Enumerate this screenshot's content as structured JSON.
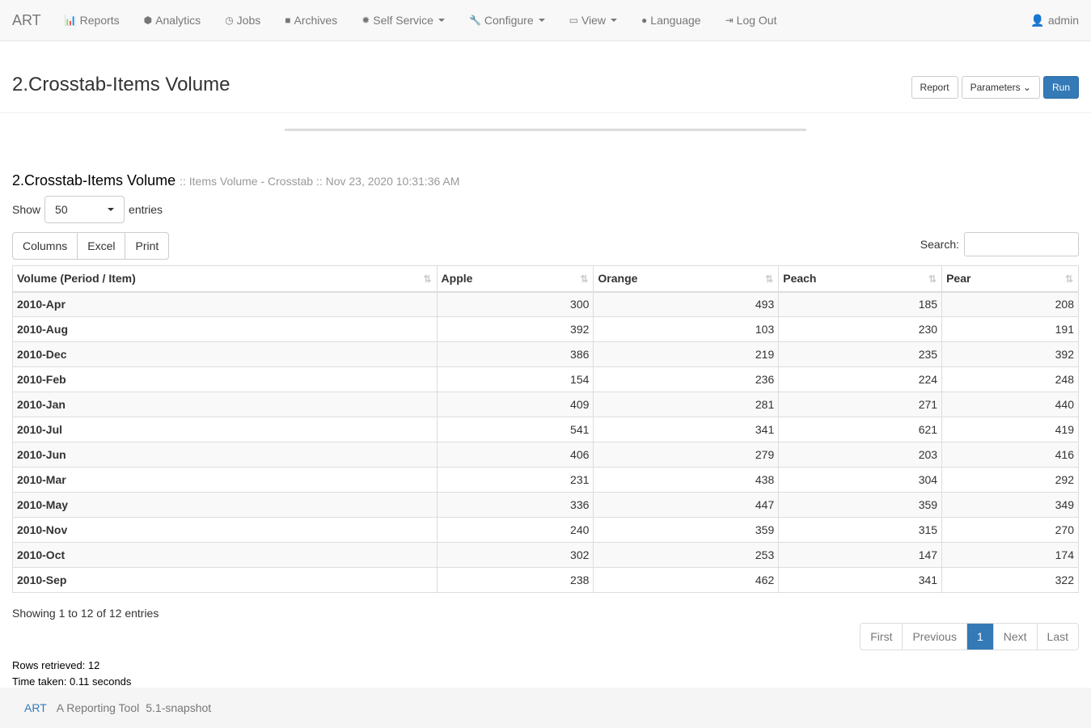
{
  "nav": {
    "brand": "ART",
    "items": [
      {
        "label": "Reports",
        "icon": "bar-chart-icon",
        "glyph": "📊"
      },
      {
        "label": "Analytics",
        "icon": "cubes-icon",
        "glyph": "⬢"
      },
      {
        "label": "Jobs",
        "icon": "clock-icon",
        "glyph": "◷"
      },
      {
        "label": "Archives",
        "icon": "archive-icon",
        "glyph": "■"
      },
      {
        "label": "Self Service",
        "icon": "gear-icon",
        "glyph": "✹"
      },
      {
        "label": "Configure",
        "icon": "wrench-icon",
        "glyph": "🔧"
      },
      {
        "label": "View",
        "icon": "monitor-icon",
        "glyph": "▭"
      },
      {
        "label": "Language",
        "icon": "comment-icon",
        "glyph": "●"
      },
      {
        "label": "Log Out",
        "icon": "logout-icon",
        "glyph": "⇥"
      }
    ],
    "user": "admin"
  },
  "header": {
    "title": "2.Crosstab-Items Volume",
    "report": "Report",
    "parameters": "Parameters",
    "run": "Run"
  },
  "report": {
    "title": "2.Crosstab-Items Volume",
    "subtitle": ":: Items Volume - Crosstab :: Nov 23, 2020 10:31:36 AM",
    "show": "Show",
    "entries_value": "50",
    "entries": "entries",
    "buttons": [
      "Columns",
      "Excel",
      "Print"
    ],
    "search": "Search:"
  },
  "table": {
    "headers": [
      "Volume (Period / Item)",
      "Apple",
      "Orange",
      "Peach",
      "Pear"
    ],
    "rows": [
      [
        "2010-Apr",
        "300",
        "493",
        "185",
        "208"
      ],
      [
        "2010-Aug",
        "392",
        "103",
        "230",
        "191"
      ],
      [
        "2010-Dec",
        "386",
        "219",
        "235",
        "392"
      ],
      [
        "2010-Feb",
        "154",
        "236",
        "224",
        "248"
      ],
      [
        "2010-Jan",
        "409",
        "281",
        "271",
        "440"
      ],
      [
        "2010-Jul",
        "541",
        "341",
        "621",
        "419"
      ],
      [
        "2010-Jun",
        "406",
        "279",
        "203",
        "416"
      ],
      [
        "2010-Mar",
        "231",
        "438",
        "304",
        "292"
      ],
      [
        "2010-May",
        "336",
        "447",
        "359",
        "349"
      ],
      [
        "2010-Nov",
        "240",
        "359",
        "315",
        "270"
      ],
      [
        "2010-Oct",
        "302",
        "253",
        "147",
        "174"
      ],
      [
        "2010-Sep",
        "238",
        "462",
        "341",
        "322"
      ]
    ]
  },
  "info": "Showing 1 to 12 of 12 entries",
  "pager": [
    "First",
    "Previous",
    "1",
    "Next",
    "Last"
  ],
  "stats": {
    "rows": "Rows retrieved: 12",
    "time": "Time taken: 0.11 seconds"
  },
  "footer": {
    "brand": "ART",
    "name": "A Reporting Tool",
    "version": "5.1-snapshot"
  }
}
